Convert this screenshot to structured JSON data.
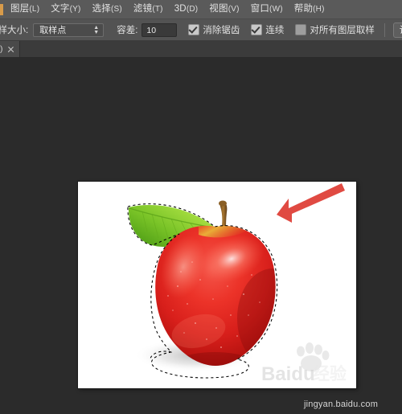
{
  "app": {
    "title": "Adobe Photoshop",
    "accent": "#d89b4a"
  },
  "menubar": {
    "items": [
      {
        "label": "图层",
        "mnemonic": "(L)",
        "name": "menu-layer"
      },
      {
        "label": "文字",
        "mnemonic": "(Y)",
        "name": "menu-type"
      },
      {
        "label": "选择",
        "mnemonic": "(S)",
        "name": "menu-select"
      },
      {
        "label": "滤镜",
        "mnemonic": "(T)",
        "name": "menu-filter"
      },
      {
        "label": "3D",
        "mnemonic": "(D)",
        "name": "menu-3d"
      },
      {
        "label": "视图",
        "mnemonic": "(V)",
        "name": "menu-view"
      },
      {
        "label": "窗口",
        "mnemonic": "(W)",
        "name": "menu-window"
      },
      {
        "label": "帮助",
        "mnemonic": "(H)",
        "name": "menu-help"
      }
    ]
  },
  "options_bar": {
    "sample_size_label": "取样大小:",
    "sample_size_value": "取样点",
    "tolerance_label": "容差:",
    "tolerance_value": "10",
    "anti_alias_label": "消除锯齿",
    "anti_alias_checked": true,
    "contiguous_label": "连续",
    "contiguous_checked": true,
    "all_layers_label": "对所有图层取样",
    "all_layers_checked": false,
    "refine_edge_label": "调整边缘"
  },
  "tabbar": {
    "tab_name": ")",
    "close_icon": "close-icon"
  },
  "canvas": {
    "image_subject": "red apple with green leaf",
    "selection_state": "marching-ants active",
    "annotation": {
      "type": "arrow",
      "color": "#e04a42",
      "points_to": "apple right edge"
    },
    "background": "#ffffff"
  },
  "watermark": {
    "brand": "Baidu",
    "brand_cn": "经验",
    "url": "jingyan.baidu.com"
  }
}
